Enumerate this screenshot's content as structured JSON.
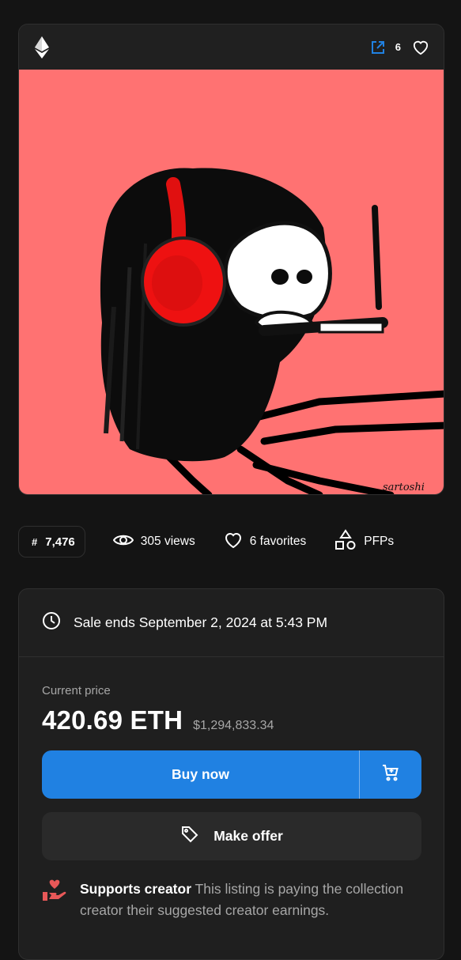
{
  "card": {
    "favorites_count": "6",
    "artwork_signature": "sartoshi",
    "icons": {
      "chain": "ethereum-icon",
      "external": "external-link-icon",
      "favorite": "heart-icon"
    },
    "colors": {
      "artwork_background": "#ff7272",
      "link_icon": "#2081e2"
    }
  },
  "stats": {
    "token_prefix": "#",
    "token_id": "7,476",
    "views": "305 views",
    "favorites": "6 favorites",
    "category": "PFPs"
  },
  "sale": {
    "ends_text": "Sale ends September 2, 2024 at 5:43 PM",
    "price_label": "Current price",
    "price_eth": "420.69 ETH",
    "price_usd": "$1,294,833.34",
    "buy_now_label": "Buy now",
    "make_offer_label": "Make offer",
    "creator_title": "Supports creator",
    "creator_text": "This listing is paying the collection creator their suggested creator earnings.",
    "colors": {
      "primary": "#2081e2",
      "creator_icon": "#e85858"
    }
  }
}
